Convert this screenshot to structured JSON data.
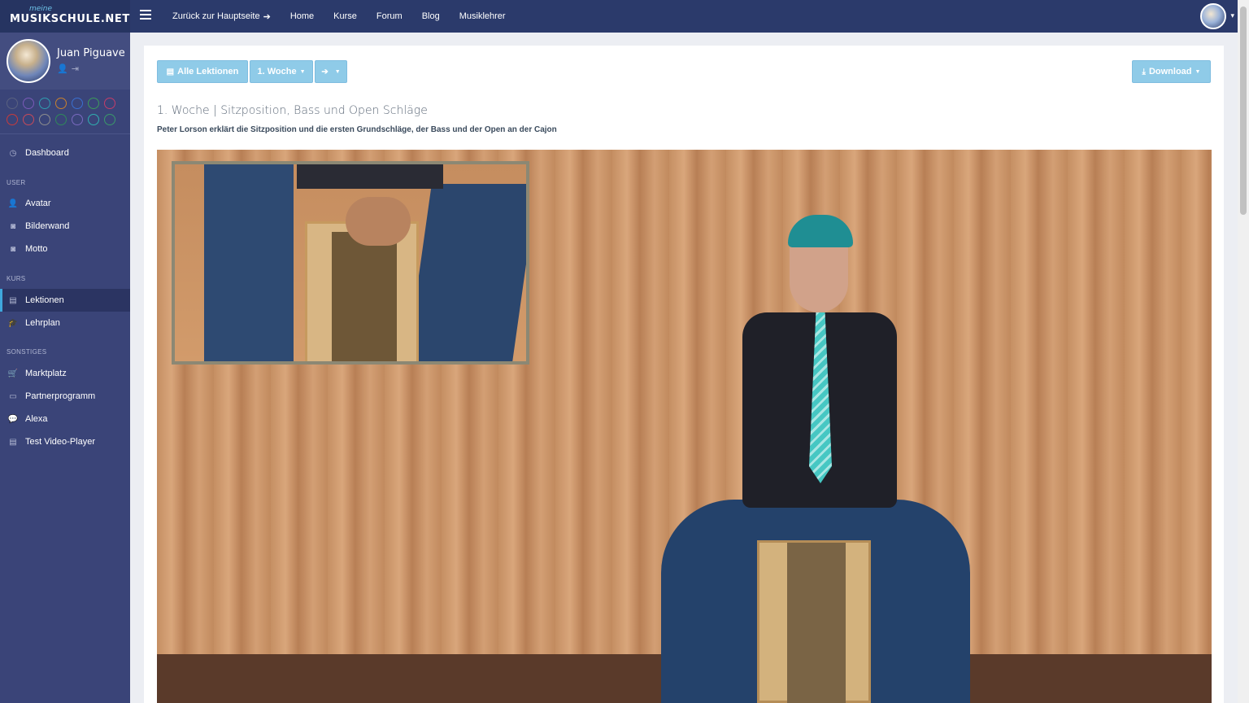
{
  "brand": {
    "small": "meine",
    "main": "MUSIKSCHULE.NET"
  },
  "topnav": {
    "items": [
      {
        "label": "Zurück zur Hauptseite",
        "arrow": "➔"
      },
      {
        "label": "Home"
      },
      {
        "label": "Kurse"
      },
      {
        "label": "Forum"
      },
      {
        "label": "Blog"
      },
      {
        "label": "Musiklehrer"
      }
    ],
    "user_caret": "▾"
  },
  "profile": {
    "name": "Juan Piguave",
    "icons": "👤⇥"
  },
  "theme_colors": [
    [
      "#5a6280",
      "#7a5ab8",
      "#2f9db0",
      "#c9812e",
      "#3a6fd0",
      "#3d9a5a",
      "#c43d6a"
    ],
    [
      "#c83b3b",
      "#c84a5a",
      "#8e8e8e",
      "#2f8a5a",
      "#7a6ac0",
      "#2fb0b0",
      "#3a9a6a"
    ]
  ],
  "sidebar": {
    "dashboard": {
      "icon": "◷",
      "label": "Dashboard"
    },
    "user_header": "USER",
    "user_items": [
      {
        "icon": "👤",
        "label": "Avatar"
      },
      {
        "icon": "◙",
        "label": "Bilderwand"
      },
      {
        "icon": "◙",
        "label": "Motto"
      }
    ],
    "kurs_header": "KURS",
    "kurs_items": [
      {
        "icon": "▤",
        "label": "Lektionen"
      },
      {
        "icon": "🎓",
        "label": "Lehrplan"
      }
    ],
    "sonstiges_header": "SONSTIGES",
    "sonstiges_items": [
      {
        "icon": "🛒",
        "label": "Marktplatz"
      },
      {
        "icon": "▭",
        "label": "Partnerprogramm"
      },
      {
        "icon": "💬",
        "label": "Alexa"
      },
      {
        "icon": "▤",
        "label": "Test Video-Player"
      }
    ]
  },
  "toolbar": {
    "all_lessons": {
      "icon": "▤",
      "label": "Alle Lektionen"
    },
    "week": {
      "label": "1. Woche",
      "caret": "▼"
    },
    "next": {
      "icon": "➔",
      "caret": "▼"
    },
    "download": {
      "icon": "⤓",
      "label": "Download",
      "caret": "▼"
    }
  },
  "lesson": {
    "title": "1. Woche | Sitzposition, Bass und Open Schläge",
    "description": "Peter Lorson erklärt die Sitzposition und die ersten Grundschläge, der Bass und der Open an der Cajon"
  }
}
